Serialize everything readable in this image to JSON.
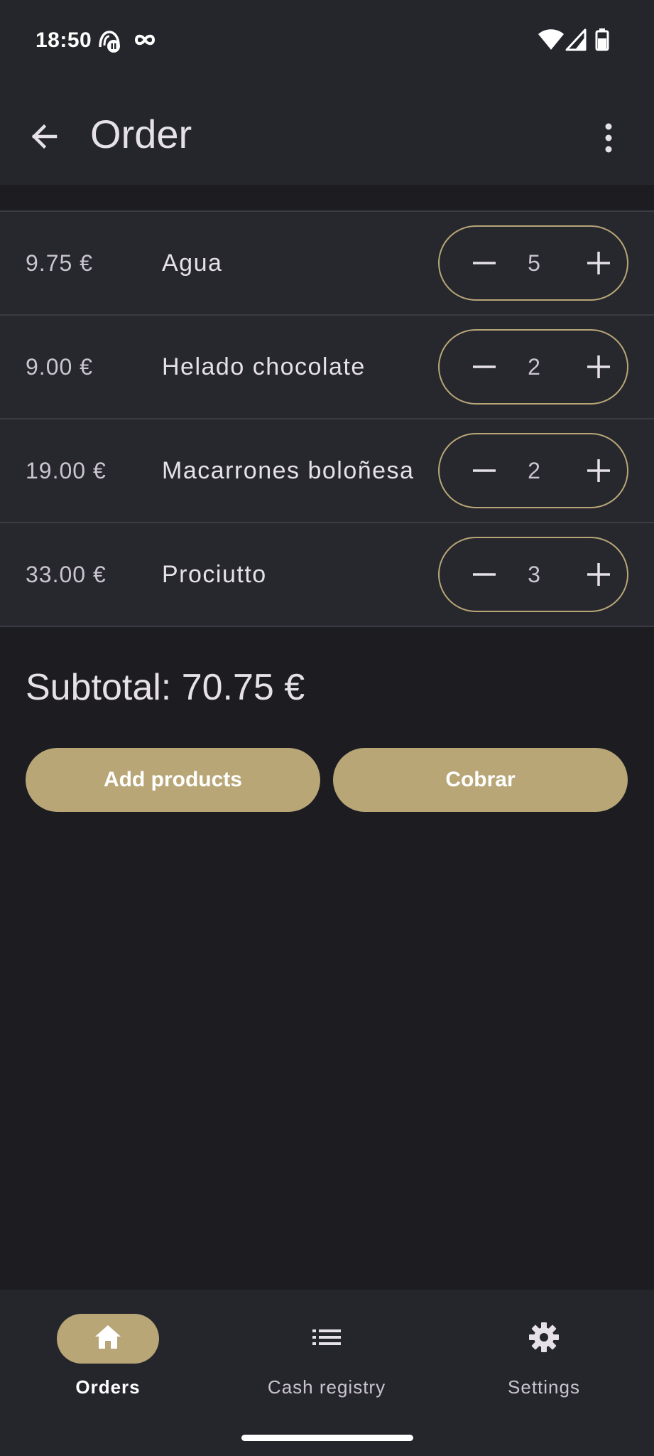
{
  "status_bar": {
    "time": "18:50",
    "icons": [
      "notification-icon",
      "infinity-icon",
      "wifi-icon",
      "signal-icon",
      "battery-icon"
    ]
  },
  "app_bar": {
    "title": "Order",
    "back_icon": "arrow-back-icon",
    "menu_icon": "more-vert-icon"
  },
  "order": {
    "items": [
      {
        "price": "9.75 €",
        "name": "Agua",
        "quantity": "5"
      },
      {
        "price": "9.00 €",
        "name": "Helado chocolate",
        "quantity": "2"
      },
      {
        "price": "19.00 €",
        "name": "Macarrones boloñesa",
        "quantity": "2"
      },
      {
        "price": "33.00 €",
        "name": "Prociutto",
        "quantity": "3"
      }
    ],
    "subtotal_label": "Subtotal:",
    "subtotal_value": "70.75 €"
  },
  "actions": {
    "add_products": "Add products",
    "cobrar": "Cobrar"
  },
  "nav": {
    "items": [
      {
        "label": "Orders",
        "icon": "home-icon",
        "active": true
      },
      {
        "label": "Cash registry",
        "icon": "list-icon",
        "active": false
      },
      {
        "label": "Settings",
        "icon": "gear-icon",
        "active": false
      }
    ]
  },
  "colors": {
    "background": "#1d1c21",
    "surface": "#27272e",
    "accent": "#b8a677",
    "divider": "#3b3b43"
  }
}
